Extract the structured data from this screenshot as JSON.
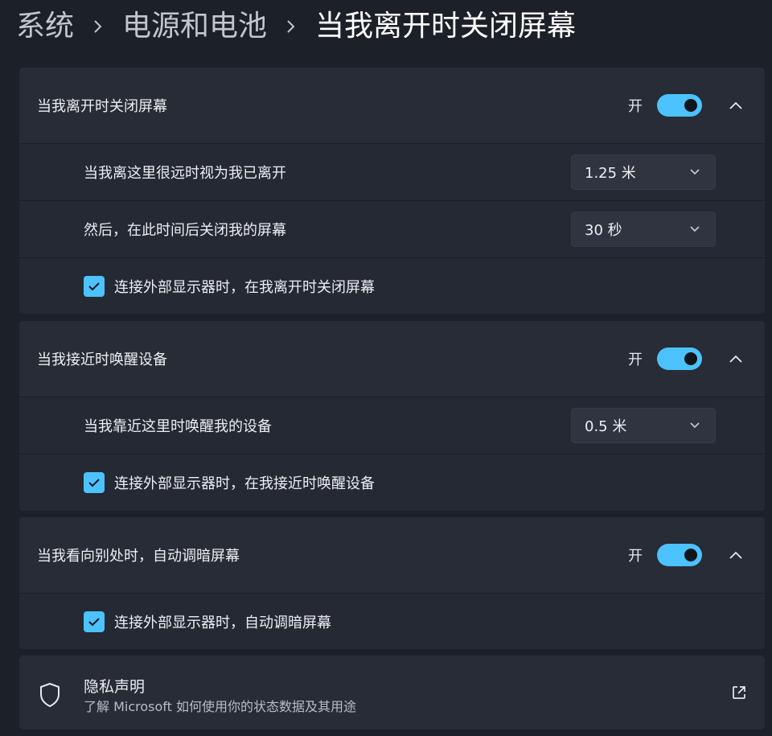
{
  "breadcrumb": {
    "items": [
      "系统",
      "电源和电池",
      "当我离开时关闭屏幕"
    ]
  },
  "section1": {
    "title": "当我离开时关闭屏幕",
    "toggle_state": "开",
    "distance_label": "当我离这里很远时视为我已离开",
    "distance_value": "1.25 米",
    "timeout_label": "然后，在此时间后关闭我的屏幕",
    "timeout_value": "30 秒",
    "checkbox_label": "连接外部显示器时，在我离开时关闭屏幕"
  },
  "section2": {
    "title": "当我接近时唤醒设备",
    "toggle_state": "开",
    "distance_label": "当我靠近这里时唤醒我的设备",
    "distance_value": "0.5 米",
    "checkbox_label": "连接外部显示器时，在我接近时唤醒设备"
  },
  "section3": {
    "title": "当我看向别处时，自动调暗屏幕",
    "toggle_state": "开",
    "checkbox_label": "连接外部显示器时，自动调暗屏幕"
  },
  "privacy": {
    "title": "隐私声明",
    "description": "了解 Microsoft 如何使用你的状态数据及其用途"
  },
  "colors": {
    "accent": "#4cc2ff",
    "background": "#1c2029",
    "card": "#262b35"
  }
}
